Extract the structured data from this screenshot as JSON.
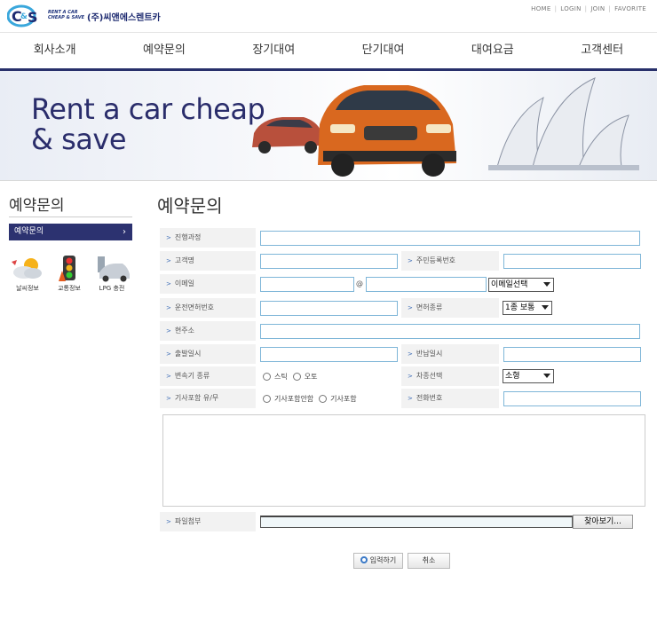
{
  "header": {
    "logo_text_line1": "RENT A CAR",
    "logo_text_line2": "CHEAP & SAVE",
    "logo_mark": "C&S",
    "company_name": "(주)씨앤에스렌트카",
    "util_links": [
      "HOME",
      "LOGIN",
      "JOIN",
      "FAVORITE"
    ]
  },
  "nav": [
    "회사소개",
    "예약문의",
    "장기대여",
    "단기대여",
    "대여요금",
    "고객센터"
  ],
  "banner": {
    "line1": "Rent a car cheap",
    "line2": "& save"
  },
  "sidebar": {
    "title": "예약문의",
    "menu_item": "예약문의",
    "quick_links": [
      {
        "label": "날씨정보",
        "icon": "weather-icon"
      },
      {
        "label": "교통정보",
        "icon": "traffic-light-icon"
      },
      {
        "label": "LPG 충전",
        "icon": "lpg-car-icon"
      }
    ]
  },
  "main": {
    "title": "예약문의",
    "labels": {
      "progress": "진행과정",
      "customer": "고객명",
      "resident_no": "주민등록번호",
      "email": "이메일",
      "license_no": "운전면허번호",
      "license_type": "면허종류",
      "address": "현주소",
      "departure": "출발일시",
      "return": "반납일시",
      "transmission": "변속기 종류",
      "car_type": "차종선택",
      "driver": "기사포함 유/무",
      "phone": "전화번호",
      "attachment": "파일첨부"
    },
    "email_at": "@",
    "email_select": "이메일선택",
    "license_select": "1종 보통",
    "car_select": "소형",
    "transmission_options": [
      "스틱",
      "오토"
    ],
    "driver_options": [
      "기사포함안함",
      "기사포함"
    ],
    "browse_button": "찾아보기...",
    "submit_button": "입력하기",
    "cancel_button": "취소"
  }
}
